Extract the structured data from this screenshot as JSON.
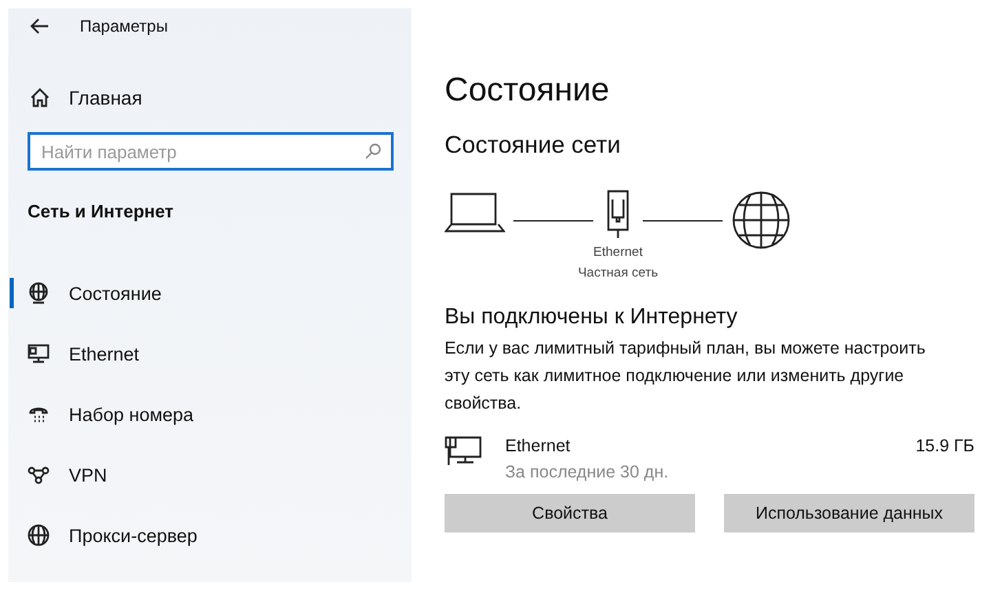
{
  "window": {
    "title": "Параметры"
  },
  "sidebar": {
    "home": "Главная",
    "search": {
      "placeholder": "Найти параметр"
    },
    "section": "Сеть и Интернет",
    "items": [
      {
        "label": "Состояние",
        "kind": "status",
        "selected": true
      },
      {
        "label": "Ethernet",
        "kind": "ethernet",
        "selected": false
      },
      {
        "label": "Набор номера",
        "kind": "dialup",
        "selected": false
      },
      {
        "label": "VPN",
        "kind": "vpn",
        "selected": false
      },
      {
        "label": "Прокси-сервер",
        "kind": "proxy",
        "selected": false
      }
    ]
  },
  "main": {
    "title": "Состояние",
    "subtitle": "Состояние сети",
    "diagram": {
      "adapter": "Ethernet",
      "network": "Частная сеть"
    },
    "connected": "Вы подключены к Интернету",
    "description": "Если у вас лимитный тарифный план, вы можете настроить эту сеть как лимитное подключение или изменить другие свойства.",
    "usage": {
      "name": "Ethernet",
      "period": "За последние 30 дн.",
      "amount": "15.9 ГБ"
    },
    "buttons": [
      "Свойства",
      "Использование данных"
    ]
  }
}
